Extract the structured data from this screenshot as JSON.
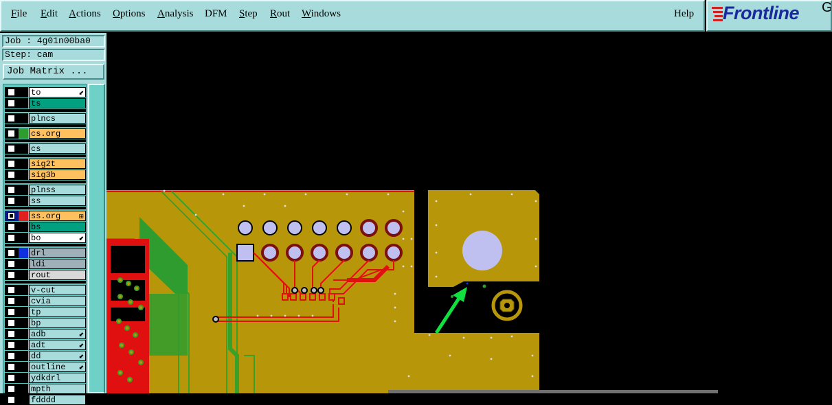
{
  "menubar": {
    "items": [
      {
        "label": "File",
        "underline": true
      },
      {
        "label": "Edit",
        "underline": true
      },
      {
        "label": "Actions",
        "underline": true
      },
      {
        "label": "Options",
        "underline": true
      },
      {
        "label": "Analysis",
        "underline": true
      },
      {
        "label": "DFM",
        "underline": false
      },
      {
        "label": "Step",
        "underline": true
      },
      {
        "label": "Rout",
        "underline": true
      },
      {
        "label": "Windows",
        "underline": true
      }
    ],
    "help_label": "Help"
  },
  "logo": {
    "text": "Frontline",
    "trailing": "G"
  },
  "job": {
    "job_label": "Job : 4g01n00ba0",
    "step_label": "Step: cam",
    "matrix_button": "Job Matrix ..."
  },
  "layers": [
    {
      "name": "to",
      "bg": "#ffffff",
      "swatch": "#000000",
      "checked": false,
      "mark": "⬋",
      "group": 0
    },
    {
      "name": "ts",
      "bg": "#00a080",
      "swatch": "#000000",
      "checked": false,
      "mark": "",
      "group": 0
    },
    {
      "name": "plncs",
      "bg": "#a8dcdc",
      "swatch": "#000000",
      "checked": false,
      "mark": "",
      "group": 1
    },
    {
      "name": "cs.org",
      "bg": "#ffc060",
      "swatch": "#2e9c2e",
      "checked": false,
      "mark": "",
      "group": 2
    },
    {
      "name": "cs",
      "bg": "#a8dcdc",
      "swatch": "#000000",
      "checked": false,
      "mark": "",
      "group": 3
    },
    {
      "name": "sig2t",
      "bg": "#ffc060",
      "swatch": "#000000",
      "checked": false,
      "mark": "",
      "group": 4
    },
    {
      "name": "sig3b",
      "bg": "#ffc060",
      "swatch": "#000000",
      "checked": false,
      "mark": "",
      "group": 4
    },
    {
      "name": "plnss",
      "bg": "#a8dcdc",
      "swatch": "#000000",
      "checked": false,
      "mark": "",
      "group": 5
    },
    {
      "name": "ss",
      "bg": "#a8dcdc",
      "swatch": "#000000",
      "checked": false,
      "mark": "",
      "group": 5
    },
    {
      "name": "ss.org",
      "bg": "#ffc060",
      "swatch": "#e02020",
      "checked": true,
      "mark": "⊞",
      "group": 6,
      "cbcell": "#0a1a8a"
    },
    {
      "name": "bs",
      "bg": "#00a080",
      "swatch": "#000000",
      "checked": false,
      "mark": "",
      "group": 6
    },
    {
      "name": "bo",
      "bg": "#ffffff",
      "swatch": "#000000",
      "checked": false,
      "mark": "⬋",
      "group": 6
    },
    {
      "name": "drl",
      "bg": "#a0b0b8",
      "swatch": "#1030e0",
      "checked": false,
      "mark": "",
      "group": 7
    },
    {
      "name": "ldi",
      "bg": "#a0b0b8",
      "swatch": "#000000",
      "checked": false,
      "mark": "",
      "group": 7
    },
    {
      "name": "rout",
      "bg": "#d8d8d8",
      "swatch": "#000000",
      "checked": false,
      "mark": "",
      "group": 7
    },
    {
      "name": "v-cut",
      "bg": "#a8dcdc",
      "swatch": "#000000",
      "checked": false,
      "mark": "",
      "group": 8
    },
    {
      "name": "cvia",
      "bg": "#a8dcdc",
      "swatch": "#000000",
      "checked": false,
      "mark": "",
      "group": 8
    },
    {
      "name": "tp",
      "bg": "#a8dcdc",
      "swatch": "#000000",
      "checked": false,
      "mark": "",
      "group": 8
    },
    {
      "name": "bp",
      "bg": "#a8dcdc",
      "swatch": "#000000",
      "checked": false,
      "mark": "",
      "group": 8
    },
    {
      "name": "adb",
      "bg": "#a8dcdc",
      "swatch": "#000000",
      "checked": false,
      "mark": "⬋",
      "group": 8
    },
    {
      "name": "adt",
      "bg": "#a8dcdc",
      "swatch": "#000000",
      "checked": false,
      "mark": "⬋",
      "group": 8
    },
    {
      "name": "dd",
      "bg": "#a8dcdc",
      "swatch": "#000000",
      "checked": false,
      "mark": "⬋",
      "group": 8
    },
    {
      "name": "outline",
      "bg": "#a8dcdc",
      "swatch": "#000000",
      "checked": false,
      "mark": "⬋",
      "group": 8
    },
    {
      "name": "ydkdrl",
      "bg": "#a8dcdc",
      "swatch": "#000000",
      "checked": false,
      "mark": "",
      "group": 8
    },
    {
      "name": "mpth",
      "bg": "#a8dcdc",
      "swatch": "#000000",
      "checked": false,
      "mark": "",
      "group": 8
    },
    {
      "name": "fdddd",
      "bg": "#a8dcdc",
      "swatch": "#000000",
      "checked": false,
      "mark": "",
      "group": 8
    }
  ],
  "colors": {
    "copper": "#b8960a",
    "trace_red": "#e01010",
    "trace_green": "#3aa02a",
    "pad_fill": "#c0c0f0",
    "arrow": "#10e040"
  }
}
